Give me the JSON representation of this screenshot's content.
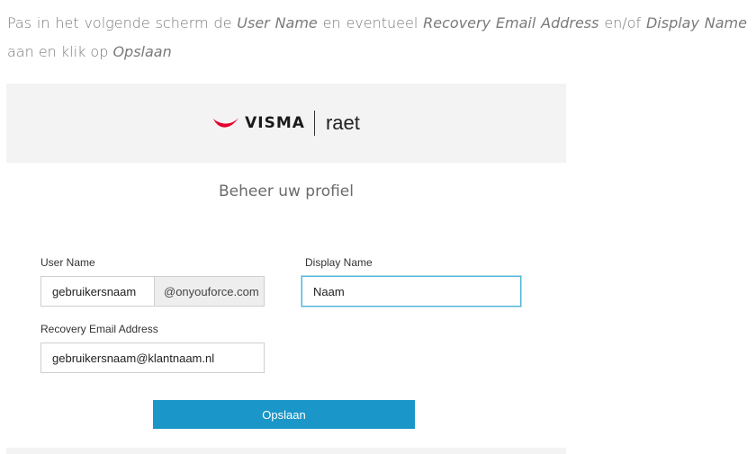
{
  "intro": {
    "t1": "Pas in het volgende scherm de ",
    "t2": "User Name",
    "t3": " en eventueel ",
    "t4": "Recovery Email Address",
    "t5": " en/of ",
    "t6": "Display Name",
    "t7": " aan en klik op ",
    "t8": "Opslaan"
  },
  "brand": {
    "name": "VISMA",
    "product": "raet",
    "logo_color": "#e4002b"
  },
  "form": {
    "heading": "Beheer uw profiel",
    "user_name_label": "User Name",
    "user_name_value": "gebruikersnaam",
    "user_name_suffix": "@onyouforce.com",
    "display_name_label": "Display Name",
    "display_name_value": "Naam",
    "recovery_label": "Recovery Email Address",
    "recovery_value": "gebruikersnaam@klantnaam.nl",
    "save_label": "Opslaan",
    "accent": "#1a96c8"
  }
}
